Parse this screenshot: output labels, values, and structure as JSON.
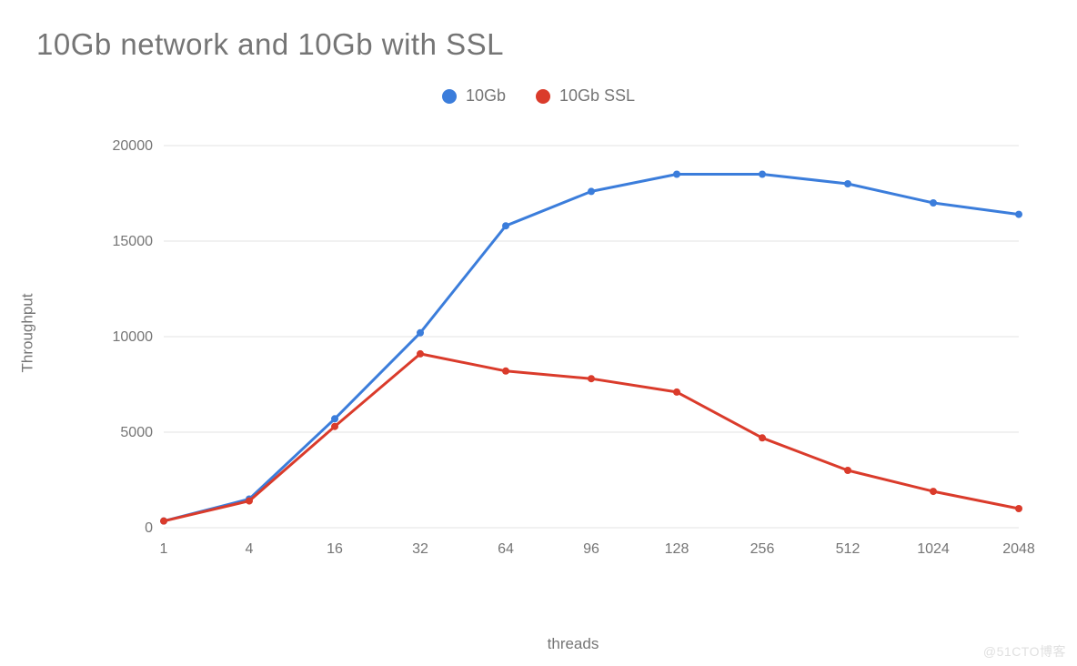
{
  "title": "10Gb network and 10Gb with SSL",
  "xlabel": "threads",
  "ylabel": "Throughput",
  "watermark": "@51CTO博客",
  "legend": {
    "s1": "10Gb",
    "s2": "10Gb SSL"
  },
  "colors": {
    "s1": "#3b7ddb",
    "s2": "#da3b2b"
  },
  "chart_data": {
    "type": "line",
    "categories": [
      "1",
      "4",
      "16",
      "32",
      "64",
      "96",
      "128",
      "256",
      "512",
      "1024",
      "2048"
    ],
    "series": [
      {
        "name": "10Gb",
        "values": [
          350,
          1500,
          5700,
          10200,
          15800,
          17600,
          18500,
          18500,
          18000,
          17000,
          16400
        ]
      },
      {
        "name": "10Gb SSL",
        "values": [
          350,
          1400,
          5300,
          9100,
          8200,
          7800,
          7100,
          4700,
          3000,
          1900,
          1000
        ]
      }
    ],
    "ylim": [
      0,
      20000
    ],
    "yticks": [
      0,
      5000,
      10000,
      15000,
      20000
    ],
    "grid": true,
    "legend_position": "top"
  }
}
